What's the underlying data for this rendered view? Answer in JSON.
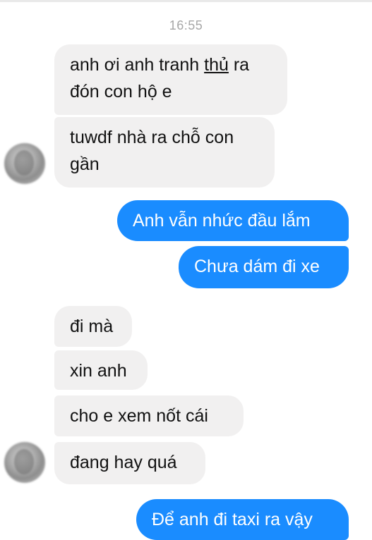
{
  "conversation": {
    "timestamp": "16:55",
    "messages": [
      {
        "from": "other",
        "text_line1_before": "anh ơi anh tranh ",
        "text_line1_underlined": "thủ",
        "text_line1_after": " ra",
        "text_line2": "đón con hộ e"
      },
      {
        "from": "other",
        "text_line1": "tuwdf nhà ra chỗ con",
        "text_line2": "gần"
      },
      {
        "from": "me",
        "text": "Anh vẫn nhức đầu lắm"
      },
      {
        "from": "me",
        "text": "Chưa dám đi xe"
      },
      {
        "from": "other",
        "text": "đi mà"
      },
      {
        "from": "other",
        "text": "xin anh"
      },
      {
        "from": "other",
        "text": "cho e xem nốt cái"
      },
      {
        "from": "other",
        "text": "đang hay quá"
      },
      {
        "from": "me",
        "text": "Để anh đi taxi ra vậy"
      }
    ]
  },
  "colors": {
    "incoming_bubble": "#f1f0f0",
    "outgoing_bubble": "#1a8cff",
    "timestamp_text": "#a7a7a7"
  }
}
